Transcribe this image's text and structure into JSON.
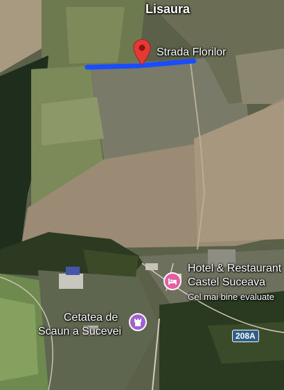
{
  "map": {
    "place_label": "Lisaura",
    "street_label": "Strada Florilor",
    "hotel": {
      "name_line1": "Hotel & Restaurant",
      "name_line2": "Castel Suceava",
      "subtitle": "Cel mai bine evaluate"
    },
    "fortress": {
      "name_line1": "Cetatea de",
      "name_line2": "Scaun a Sucevei"
    },
    "road_shield": "208A"
  },
  "colors": {
    "route": "#1a4dff",
    "pin": "#e53935",
    "hotel_icon": "#e95ca1",
    "fortress_icon": "#a25fd6",
    "shield": "#2f5f8a"
  }
}
